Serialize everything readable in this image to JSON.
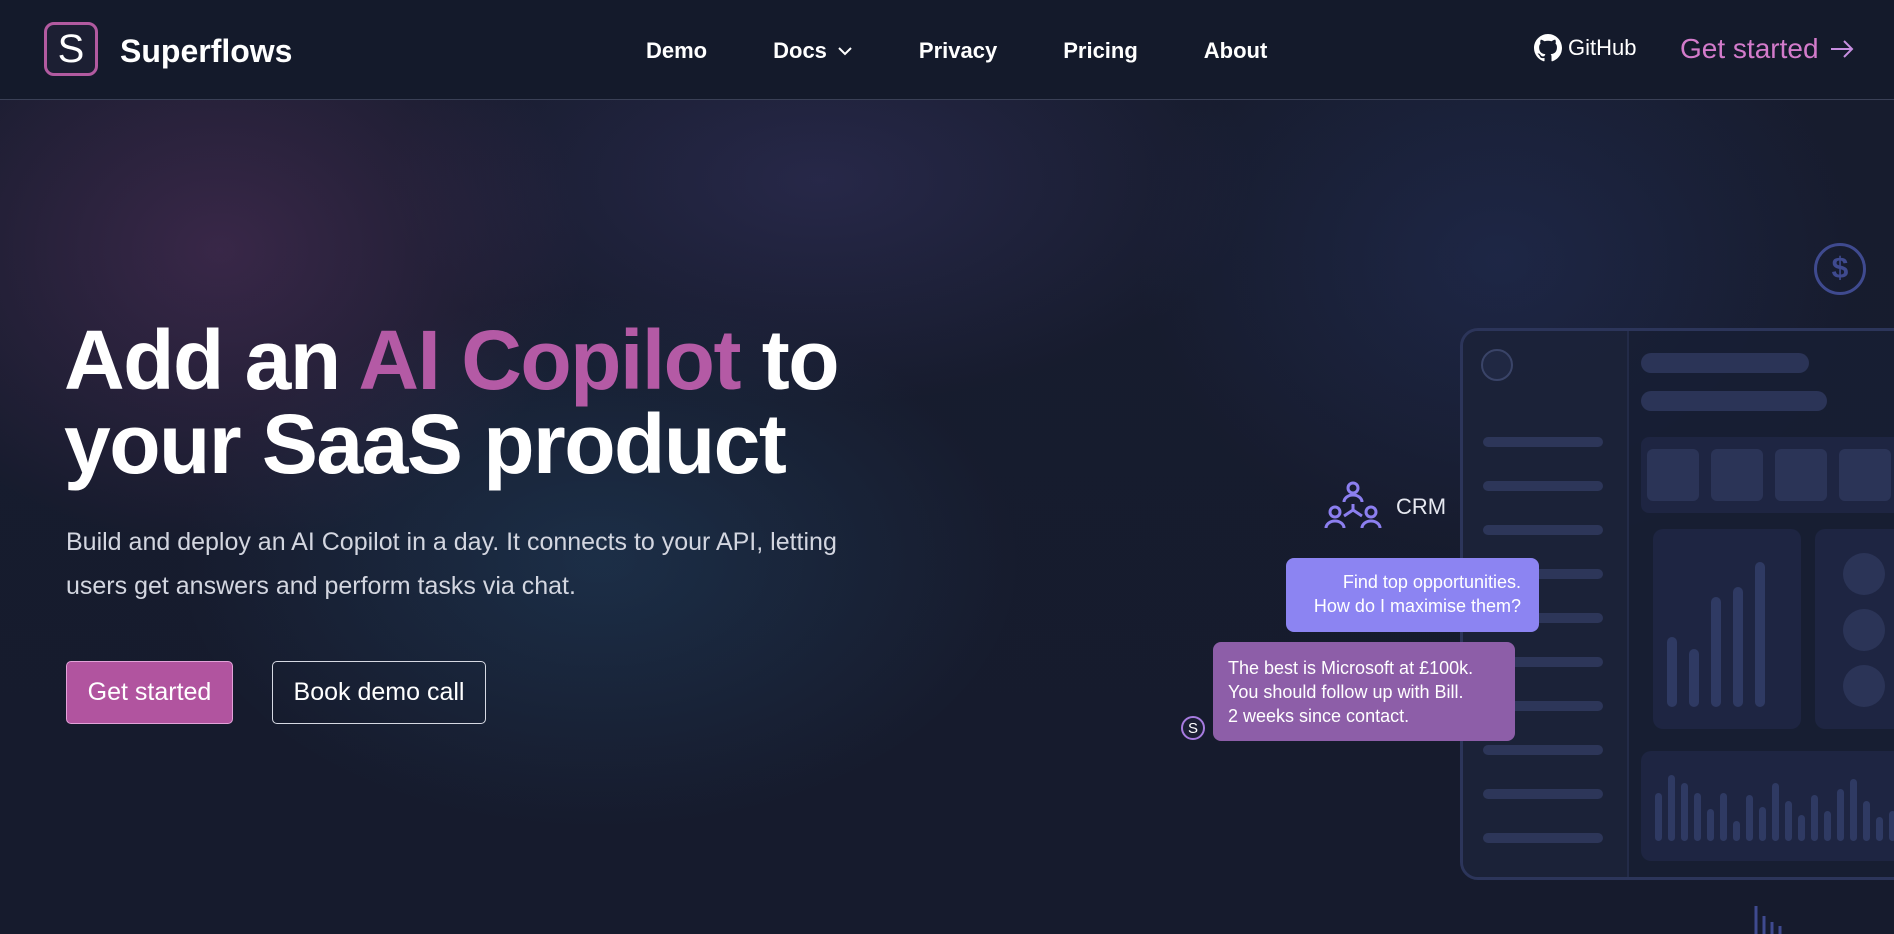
{
  "brand": {
    "name": "Superflows",
    "logo_letter": "S",
    "accent_color": "#b25aa0"
  },
  "nav": {
    "links": [
      {
        "label": "Demo"
      },
      {
        "label": "Docs",
        "has_dropdown": true
      },
      {
        "label": "Privacy"
      },
      {
        "label": "Pricing"
      },
      {
        "label": "About"
      }
    ],
    "github_label": "GitHub",
    "cta_label": "Get started"
  },
  "hero": {
    "title_prefix": "Add an ",
    "title_accent": "AI Copilot",
    "title_suffix_line1": " to",
    "title_line2": "your SaaS product",
    "subtitle_line1": "Build and deploy an AI Copilot in a day. It connects to your API, letting",
    "subtitle_line2": "users get answers and perform tasks via chat.",
    "primary_button": "Get started",
    "secondary_button": "Book demo call"
  },
  "illustration": {
    "crm_label": "CRM",
    "user_message_line1": "Find top opportunities.",
    "user_message_line2": "How do I maximise them?",
    "bot_message_line1": "The best is Microsoft at £100k.",
    "bot_message_line2": "You should follow up with Bill.",
    "bot_message_line3": "2 weeks since contact.",
    "bot_avatar_letter": "S",
    "coin_symbol": "$",
    "icons": [
      "dollar-coin-icon",
      "crm-team-icon",
      "bar-chart-icon"
    ]
  }
}
